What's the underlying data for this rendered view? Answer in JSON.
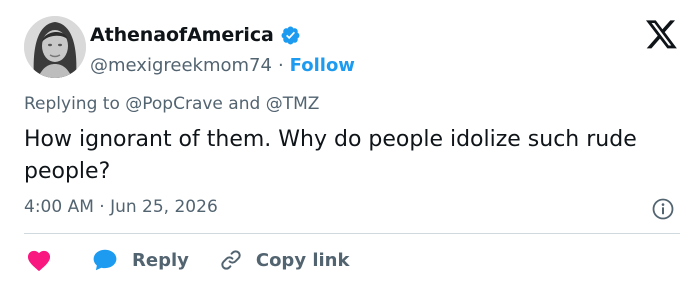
{
  "author": {
    "display_name": "AthenaofAmerica",
    "handle": "@mexigreekmom74",
    "separator": "·",
    "follow_label": "Follow"
  },
  "reply_context": {
    "prefix": "Replying to",
    "mention_1": "@PopCrave",
    "conjunction": "and",
    "mention_2": "@TMZ"
  },
  "tweet": {
    "text": "How ignorant of them. Why do people idolize such rude people?",
    "timestamp": "4:00 AM · Jun 25, 2026"
  },
  "actions": {
    "reply_label": "Reply",
    "copy_link_label": "Copy link"
  },
  "icons": {
    "verified": "verified-badge-icon",
    "brand": "x-logo-icon",
    "info": "info-icon",
    "like": "heart-icon",
    "reply": "speech-bubble-icon",
    "copy_link": "link-icon"
  },
  "colors": {
    "accent": "#1d9bf0",
    "like": "#f91880",
    "text": "#0f1419",
    "muted": "#536471"
  }
}
